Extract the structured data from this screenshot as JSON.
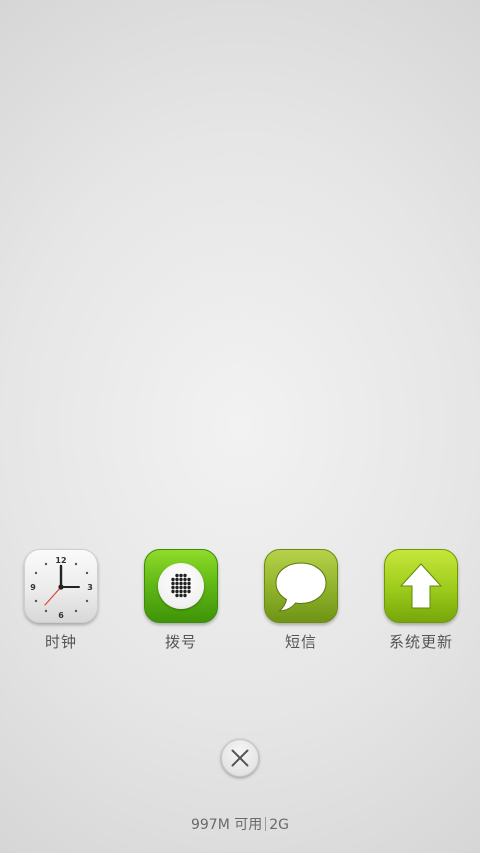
{
  "recent_apps": [
    {
      "label": "时钟",
      "icon": "clock-icon"
    },
    {
      "label": "拨号",
      "icon": "dialer-icon"
    },
    {
      "label": "短信",
      "icon": "messages-icon"
    },
    {
      "label": "系统更新",
      "icon": "update-arrow-icon"
    }
  ],
  "clock_face": {
    "numerals": [
      "12",
      "3",
      "6",
      "9"
    ]
  },
  "close_button": {
    "icon": "close-icon"
  },
  "memory": {
    "available": "997M 可用",
    "total": "2G"
  },
  "colors": {
    "dialer_green": "#5fb614",
    "messages_green": "#8fb22a",
    "update_green": "#9ccb1c",
    "clock_second_hand": "#e0443a",
    "label_text": "#555555"
  }
}
